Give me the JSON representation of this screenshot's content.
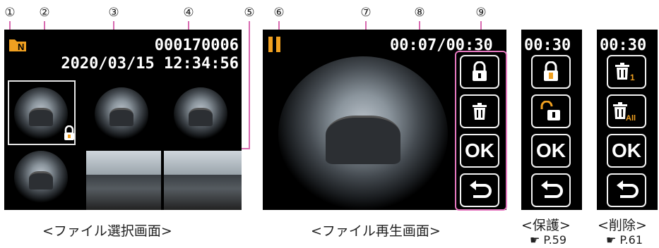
{
  "callouts": [
    "①",
    "②",
    "③",
    "④",
    "⑤",
    "⑥",
    "⑦",
    "⑧",
    "⑨"
  ],
  "select_screen": {
    "file_number": "000170006",
    "datetime": "2020/03/15 12:34:56",
    "folder_badge": "N"
  },
  "play_screen": {
    "time": "00:07/00:30"
  },
  "protect_screen": {
    "time": "00:30",
    "ok_label": "OK"
  },
  "delete_screen": {
    "time": "00:30",
    "ok_label": "OK",
    "delete_one_sub": "1",
    "delete_all_sub": "All"
  },
  "buttons": {
    "ok_label": "OK"
  },
  "captions": {
    "select": "<ファイル選択画面>",
    "play": "<ファイル再生画面>",
    "protect": "<保護>",
    "delete": "<削除>"
  },
  "page_refs": {
    "protect": "☛ P.59",
    "delete": "☛ P.61"
  },
  "colors": {
    "accent": "#f0a020",
    "callout_line": "#d86bb0",
    "highlight": "#e779c1",
    "screen_bg": "#000000"
  }
}
